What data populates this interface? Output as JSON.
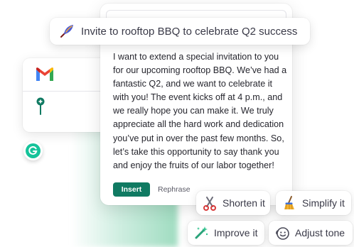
{
  "prompt": {
    "text": "Invite to rooftop BBQ to celebrate Q2 success",
    "icon": "quill-pen-icon"
  },
  "editor": {
    "body": "I want to extend a special invitation to you for our upcoming rooftop BBQ. We’ve had a fantastic Q2, and we want to celebrate it with you! The event kicks off at 4 p.m., and we really hope you can make it. We truly appreciate all the hard work and dedication you’ve put in over the past few months. So, let’s take this opportunity to say thank you and enjoy the fruits of our labor together!",
    "insert_label": "Insert",
    "rephrase_label": "Rephrase"
  },
  "suggestions": {
    "shorten": "Shorten it",
    "simplify": "Simplify it",
    "improve": "Improve it",
    "adjust": "Adjust tone"
  },
  "colors": {
    "accent": "#107a62",
    "grammarly_green": "#15c39a",
    "gmail_red": "#ea4335"
  }
}
